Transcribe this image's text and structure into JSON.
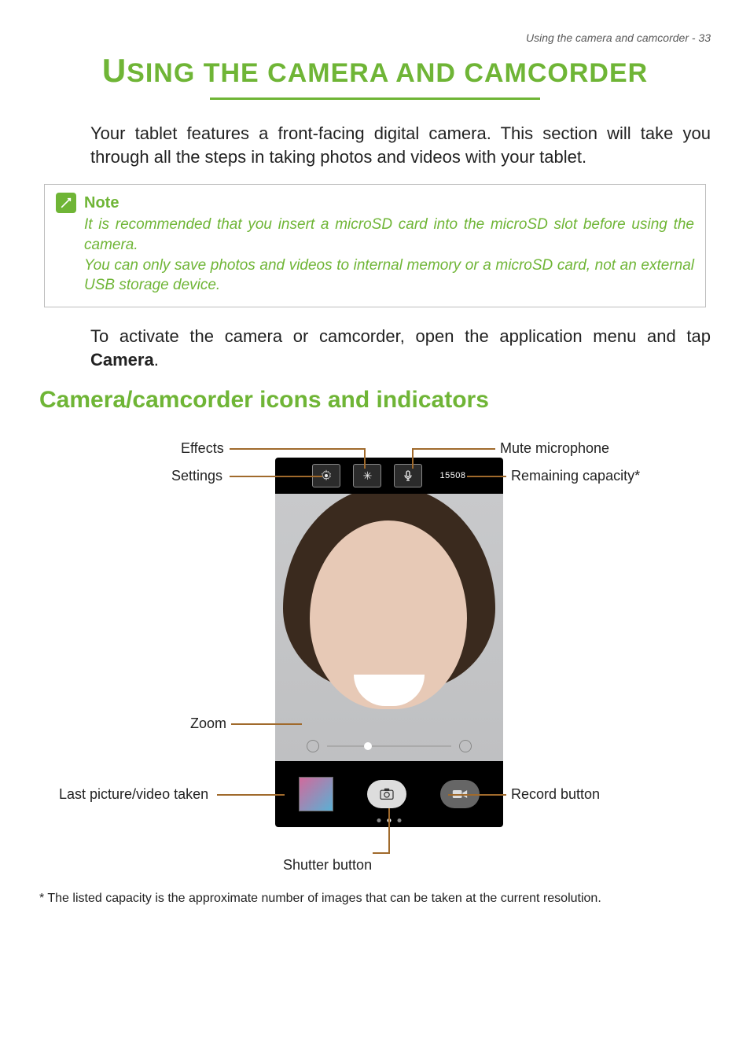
{
  "header": {
    "text": "Using the camera and camcorder - 33"
  },
  "title": "USING THE CAMERA AND CAMCORDER",
  "intro": "Your tablet features a front-facing digital camera. This section will take you through all the steps in taking photos and videos with your tablet.",
  "note": {
    "title": "Note",
    "line1": "It is recommended that you insert a microSD card into the microSD slot before using the camera.",
    "line2": "You can only save photos and videos to internal memory or a microSD card, not an external USB storage device."
  },
  "activate_text_pre": "To activate the camera or camcorder, open the application menu and tap ",
  "activate_text_bold": "Camera",
  "activate_text_post": ".",
  "section_h2": "Camera/camcorder icons and indicators",
  "labels": {
    "effects": "Effects",
    "settings": "Settings",
    "mute": "Mute microphone",
    "remaining": "Remaining capacity*",
    "zoom": "Zoom",
    "last": "Last picture/video taken",
    "record": "Record button",
    "shutter": "Shutter button"
  },
  "ui": {
    "capacity_value": "15508"
  },
  "footnote": "* The listed capacity is the approximate number of images that can be taken at the current resolution."
}
